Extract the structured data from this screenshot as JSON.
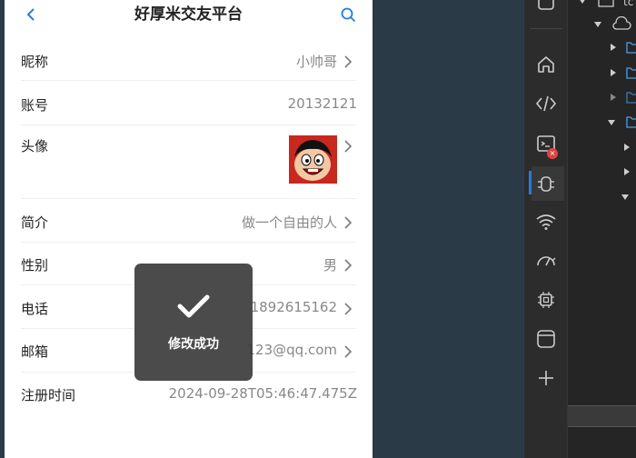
{
  "app": {
    "title": "好厚米交友平台"
  },
  "profile": {
    "rows": [
      {
        "label": "昵称",
        "value": "小帅哥"
      },
      {
        "label": "账号",
        "value": "20132121"
      },
      {
        "label": "头像",
        "value": ""
      },
      {
        "label": "简介",
        "value": "做一个自由的人"
      },
      {
        "label": "性别",
        "value": "男"
      },
      {
        "label": "电话",
        "value": "1892615162"
      },
      {
        "label": "邮箱",
        "value": "123@qq.com"
      },
      {
        "label": "注册时间",
        "value": "2024-09-28T05:46:47.475Z"
      }
    ]
  },
  "toast": {
    "text": "修改成功",
    "icon": "checkmark-icon"
  },
  "ide": {
    "activity_icons": [
      "home-icon",
      "code-icon",
      "terminal-icon",
      "debug-icon",
      "wifi-icon",
      "performance-icon",
      "chip-icon",
      "window-icon",
      "add-icon"
    ],
    "terminal_badge": "×",
    "explorer_fragment": "tc"
  },
  "colors": {
    "accent": "#1f7ee0",
    "toast_bg": "#3c3c3c",
    "badge": "#e04343",
    "page_bg": "#2b3a47"
  }
}
